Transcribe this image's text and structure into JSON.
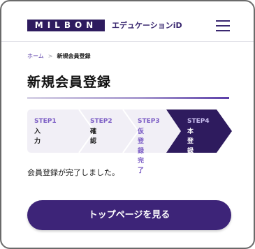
{
  "header": {
    "logo_text": "MILBON",
    "service_name": "エデュケーションiD",
    "menu_icon": "hamburger-menu-icon"
  },
  "breadcrumb": {
    "home": "ホーム",
    "separator": ">",
    "current": "新規会員登録"
  },
  "page": {
    "title": "新規会員登録"
  },
  "steps": [
    {
      "number": "STEP1",
      "label": "入力",
      "state": "done"
    },
    {
      "number": "STEP2",
      "label": "確認",
      "state": "done"
    },
    {
      "number": "STEP3",
      "label": "仮登録\n完了",
      "state": "done"
    },
    {
      "number": "STEP4",
      "label": "本登録\n完了",
      "state": "current"
    }
  ],
  "message": "会員登録が完了しました。",
  "cta": {
    "label": "トップページを見る"
  },
  "colors": {
    "brand": "#2e1b5e",
    "accent": "#5b3ea8",
    "button": "#3d2478",
    "step_inactive_bg": "#f1eff6",
    "step_active_bg": "#2e1b5e"
  }
}
